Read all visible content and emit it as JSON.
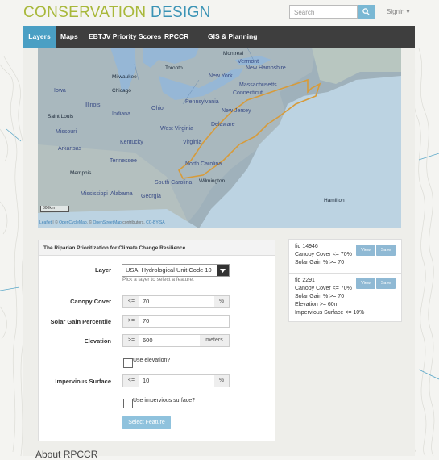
{
  "header": {
    "logo_part1": "CONSERVATION ",
    "logo_part2": "DESIGN",
    "search_placeholder": "Search",
    "signin": "Signin ▾",
    "colors": {
      "logo_green": "#a8b83a",
      "logo_blue": "#3a93b5",
      "nav_bg": "#3e3e3e",
      "nav_active": "#4a9fc4"
    }
  },
  "nav": {
    "tabs": [
      {
        "label": "Layers",
        "active": true
      },
      {
        "label": "Maps",
        "active": false
      },
      {
        "label": "EBTJV Priority Scores",
        "active": false
      },
      {
        "label": "RPCCR",
        "active": false
      },
      {
        "label": "GIS & Planning",
        "active": false
      }
    ]
  },
  "map": {
    "labels": {
      "toronto": "Toronto",
      "chicago": "Chicago",
      "milwaukee": "Milwaukee",
      "iowa": "Iowa",
      "illinois": "Illinois",
      "indiana": "Indiana",
      "ohio": "Ohio",
      "pennsylvania": "Pennsylvania",
      "new_york": "New York",
      "vermont": "Vermont",
      "new_hampshire": "New Hampshire",
      "massachusetts": "Massachusetts",
      "connecticut": "Connecticut",
      "new_jersey": "New Jersey",
      "delaware": "Delaware",
      "west_virginia": "West Virginia",
      "virginia": "Virginia",
      "kentucky": "Kentucky",
      "missouri": "Missouri",
      "tennessee": "Tennessee",
      "north_carolina": "North Carolina",
      "south_carolina": "South Carolina",
      "arkansas": "Arkansas",
      "mississippi": "Mississippi",
      "alabama": "Alabama",
      "georgia": "Georgia",
      "wilmington": "Wilmington",
      "hamilton": "Hamilton",
      "memphis": "Memphis",
      "st_louis": "Saint Louis",
      "montreal": "Montreal"
    },
    "scale": "300km",
    "attribution_leaflet": "Leaflet",
    "attribution_sep1": " | © ",
    "attribution_ocm": "OpenCycleMap",
    "attribution_sep2": ", © ",
    "attribution_osm": "OpenStreetMap",
    "attribution_contrib": " contributors, ",
    "attribution_license": "CC-BY-SA"
  },
  "panel": {
    "title": "The Riparian Prioritization for Climate Change Resilience",
    "layer_label": "Layer",
    "layer_value": "USA: Hydrological Unit Code 10",
    "layer_help": "Pick a layer to select a feature.",
    "canopy_label": "Canopy Cover",
    "canopy_op": "<=",
    "canopy_value": "70",
    "canopy_unit": "%",
    "solar_label": "Solar Gain Percentile",
    "solar_op": ">=",
    "solar_value": "70",
    "elevation_label": "Elevation",
    "elevation_op": ">=",
    "elevation_value": "600",
    "elevation_unit": "meters",
    "use_elevation": "Use elevation?",
    "impervious_label": "Impervious Surface",
    "impervious_op": "<=",
    "impervious_value": "10",
    "impervious_unit": "%",
    "use_impervious": "Use impervious surface?",
    "select_button": "Select Feature"
  },
  "results": [
    {
      "fid": "fid 14946",
      "lines": [
        "Canopy Cover <= 70%",
        "Solar Gain % >= 70"
      ],
      "view": "View",
      "save": "Save"
    },
    {
      "fid": "fid 2291",
      "lines": [
        "Canopy Cover <= 70%",
        "Solar Gain % >= 70",
        "Elevation >= 60m",
        "Impervious Surface <= 10%"
      ],
      "view": "View",
      "save": "Save"
    }
  ],
  "about_heading": "About RPCCR"
}
